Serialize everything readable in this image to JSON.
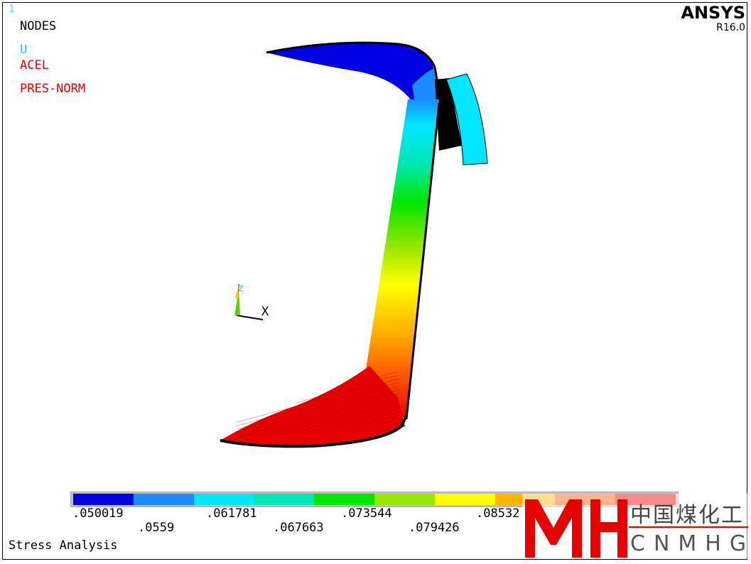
{
  "window": {
    "number": "1"
  },
  "labels": {
    "nodes": "NODES",
    "u": "U",
    "acel": "ACEL",
    "pres": "PRES-NORM"
  },
  "brand": {
    "name": "ANSYS",
    "version": "R16.0"
  },
  "triad": {
    "x_label": "X",
    "z_label": "Z"
  },
  "plot_title": "Stress Analysis",
  "legend": {
    "colors": [
      "#0000e6",
      "#1a8cff",
      "#00e6ff",
      "#00e6b4",
      "#00e600",
      "#96e600",
      "#ffff00",
      "#ffb400",
      "#ff5a00",
      "#e60000"
    ],
    "values_top": [
      ".050019",
      ".061781",
      ".073544",
      ".08532"
    ],
    "values_bottom": [
      ".0559",
      ".067663",
      ".079426"
    ]
  },
  "watermark": {
    "chinese": "中国煤化工",
    "english": "CNMHG"
  }
}
